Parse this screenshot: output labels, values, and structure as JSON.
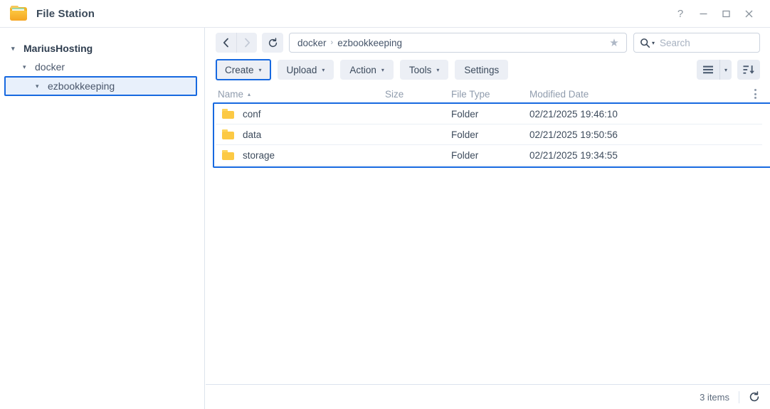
{
  "window": {
    "title": "File Station",
    "app_icon": "folder-icon",
    "controls": [
      {
        "name": "help-button",
        "glyph": "?"
      },
      {
        "name": "minimize-button",
        "glyph": "minimize-icon"
      },
      {
        "name": "maximize-button",
        "glyph": "maximize-icon"
      },
      {
        "name": "close-button",
        "glyph": "close-icon"
      }
    ]
  },
  "sidebar": {
    "items": [
      {
        "label": "MariusHosting",
        "level": 0,
        "expanded": true,
        "selected": false
      },
      {
        "label": "docker",
        "level": 1,
        "expanded": true,
        "selected": false
      },
      {
        "label": "ezbookkeeping",
        "level": 2,
        "expanded": true,
        "selected": true
      }
    ]
  },
  "navbar": {
    "back_label": "back-icon",
    "back_enabled": true,
    "forward_label": "forward-icon",
    "forward_enabled": false,
    "refresh_label": "refresh-icon",
    "breadcrumb": [
      "docker",
      "ezbookkeeping"
    ],
    "breadcrumb_separator": "›",
    "favorite_icon": "star-icon",
    "search": {
      "placeholder": "Search",
      "value": "",
      "icon": "search-icon"
    }
  },
  "toolbar": {
    "buttons": [
      {
        "label": "Create",
        "dropdown": true,
        "highlighted": true
      },
      {
        "label": "Upload",
        "dropdown": true,
        "highlighted": false
      },
      {
        "label": "Action",
        "dropdown": true,
        "highlighted": false
      },
      {
        "label": "Tools",
        "dropdown": true,
        "highlighted": false
      },
      {
        "label": "Settings",
        "dropdown": false,
        "highlighted": false
      }
    ],
    "view_mode_icon": "list-view-icon",
    "view_mode_caret": "chevron-down-icon",
    "sort_icon": "sort-descending-icon"
  },
  "filelist": {
    "columns": [
      {
        "key": "name",
        "label": "Name",
        "sort": "asc"
      },
      {
        "key": "size",
        "label": "Size",
        "sort": null
      },
      {
        "key": "type",
        "label": "File Type",
        "sort": null
      },
      {
        "key": "date",
        "label": "Modified Date",
        "sort": null
      }
    ],
    "options_icon": "kebab-menu-icon",
    "rows": [
      {
        "icon": "folder-icon",
        "name": "conf",
        "size": "",
        "type": "Folder",
        "date": "02/21/2025 19:46:10"
      },
      {
        "icon": "folder-icon",
        "name": "data",
        "size": "",
        "type": "Folder",
        "date": "02/21/2025 19:50:56"
      },
      {
        "icon": "folder-icon",
        "name": "storage",
        "size": "",
        "type": "Folder",
        "date": "02/21/2025 19:34:55"
      }
    ]
  },
  "statusbar": {
    "items_count": "3 items",
    "refresh_icon": "refresh-icon"
  },
  "colors": {
    "accent": "#1769e0",
    "folder": "#fcc944",
    "toolbar_button": "#eceff5",
    "text": "#3d4b5c",
    "muted": "#909cad",
    "selection_fill": "#e8f0fb"
  }
}
